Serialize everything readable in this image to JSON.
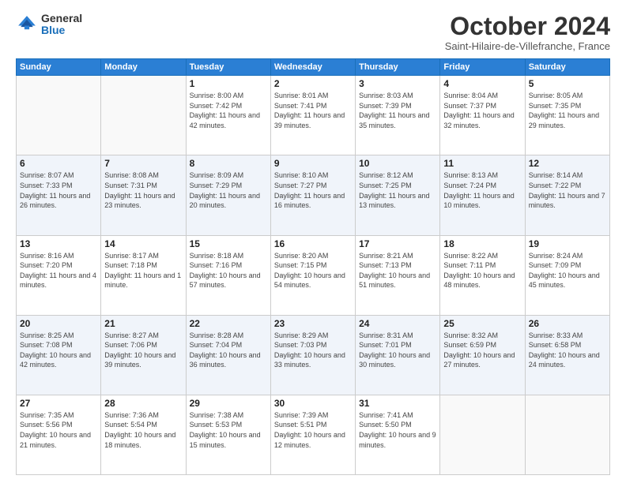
{
  "header": {
    "logo_general": "General",
    "logo_blue": "Blue",
    "title": "October 2024",
    "location": "Saint-Hilaire-de-Villefranche, France"
  },
  "weekdays": [
    "Sunday",
    "Monday",
    "Tuesday",
    "Wednesday",
    "Thursday",
    "Friday",
    "Saturday"
  ],
  "weeks": [
    [
      {
        "day": "",
        "sunrise": "",
        "sunset": "",
        "daylight": ""
      },
      {
        "day": "",
        "sunrise": "",
        "sunset": "",
        "daylight": ""
      },
      {
        "day": "1",
        "sunrise": "Sunrise: 8:00 AM",
        "sunset": "Sunset: 7:42 PM",
        "daylight": "Daylight: 11 hours and 42 minutes."
      },
      {
        "day": "2",
        "sunrise": "Sunrise: 8:01 AM",
        "sunset": "Sunset: 7:41 PM",
        "daylight": "Daylight: 11 hours and 39 minutes."
      },
      {
        "day": "3",
        "sunrise": "Sunrise: 8:03 AM",
        "sunset": "Sunset: 7:39 PM",
        "daylight": "Daylight: 11 hours and 35 minutes."
      },
      {
        "day": "4",
        "sunrise": "Sunrise: 8:04 AM",
        "sunset": "Sunset: 7:37 PM",
        "daylight": "Daylight: 11 hours and 32 minutes."
      },
      {
        "day": "5",
        "sunrise": "Sunrise: 8:05 AM",
        "sunset": "Sunset: 7:35 PM",
        "daylight": "Daylight: 11 hours and 29 minutes."
      }
    ],
    [
      {
        "day": "6",
        "sunrise": "Sunrise: 8:07 AM",
        "sunset": "Sunset: 7:33 PM",
        "daylight": "Daylight: 11 hours and 26 minutes."
      },
      {
        "day": "7",
        "sunrise": "Sunrise: 8:08 AM",
        "sunset": "Sunset: 7:31 PM",
        "daylight": "Daylight: 11 hours and 23 minutes."
      },
      {
        "day": "8",
        "sunrise": "Sunrise: 8:09 AM",
        "sunset": "Sunset: 7:29 PM",
        "daylight": "Daylight: 11 hours and 20 minutes."
      },
      {
        "day": "9",
        "sunrise": "Sunrise: 8:10 AM",
        "sunset": "Sunset: 7:27 PM",
        "daylight": "Daylight: 11 hours and 16 minutes."
      },
      {
        "day": "10",
        "sunrise": "Sunrise: 8:12 AM",
        "sunset": "Sunset: 7:25 PM",
        "daylight": "Daylight: 11 hours and 13 minutes."
      },
      {
        "day": "11",
        "sunrise": "Sunrise: 8:13 AM",
        "sunset": "Sunset: 7:24 PM",
        "daylight": "Daylight: 11 hours and 10 minutes."
      },
      {
        "day": "12",
        "sunrise": "Sunrise: 8:14 AM",
        "sunset": "Sunset: 7:22 PM",
        "daylight": "Daylight: 11 hours and 7 minutes."
      }
    ],
    [
      {
        "day": "13",
        "sunrise": "Sunrise: 8:16 AM",
        "sunset": "Sunset: 7:20 PM",
        "daylight": "Daylight: 11 hours and 4 minutes."
      },
      {
        "day": "14",
        "sunrise": "Sunrise: 8:17 AM",
        "sunset": "Sunset: 7:18 PM",
        "daylight": "Daylight: 11 hours and 1 minute."
      },
      {
        "day": "15",
        "sunrise": "Sunrise: 8:18 AM",
        "sunset": "Sunset: 7:16 PM",
        "daylight": "Daylight: 10 hours and 57 minutes."
      },
      {
        "day": "16",
        "sunrise": "Sunrise: 8:20 AM",
        "sunset": "Sunset: 7:15 PM",
        "daylight": "Daylight: 10 hours and 54 minutes."
      },
      {
        "day": "17",
        "sunrise": "Sunrise: 8:21 AM",
        "sunset": "Sunset: 7:13 PM",
        "daylight": "Daylight: 10 hours and 51 minutes."
      },
      {
        "day": "18",
        "sunrise": "Sunrise: 8:22 AM",
        "sunset": "Sunset: 7:11 PM",
        "daylight": "Daylight: 10 hours and 48 minutes."
      },
      {
        "day": "19",
        "sunrise": "Sunrise: 8:24 AM",
        "sunset": "Sunset: 7:09 PM",
        "daylight": "Daylight: 10 hours and 45 minutes."
      }
    ],
    [
      {
        "day": "20",
        "sunrise": "Sunrise: 8:25 AM",
        "sunset": "Sunset: 7:08 PM",
        "daylight": "Daylight: 10 hours and 42 minutes."
      },
      {
        "day": "21",
        "sunrise": "Sunrise: 8:27 AM",
        "sunset": "Sunset: 7:06 PM",
        "daylight": "Daylight: 10 hours and 39 minutes."
      },
      {
        "day": "22",
        "sunrise": "Sunrise: 8:28 AM",
        "sunset": "Sunset: 7:04 PM",
        "daylight": "Daylight: 10 hours and 36 minutes."
      },
      {
        "day": "23",
        "sunrise": "Sunrise: 8:29 AM",
        "sunset": "Sunset: 7:03 PM",
        "daylight": "Daylight: 10 hours and 33 minutes."
      },
      {
        "day": "24",
        "sunrise": "Sunrise: 8:31 AM",
        "sunset": "Sunset: 7:01 PM",
        "daylight": "Daylight: 10 hours and 30 minutes."
      },
      {
        "day": "25",
        "sunrise": "Sunrise: 8:32 AM",
        "sunset": "Sunset: 6:59 PM",
        "daylight": "Daylight: 10 hours and 27 minutes."
      },
      {
        "day": "26",
        "sunrise": "Sunrise: 8:33 AM",
        "sunset": "Sunset: 6:58 PM",
        "daylight": "Daylight: 10 hours and 24 minutes."
      }
    ],
    [
      {
        "day": "27",
        "sunrise": "Sunrise: 7:35 AM",
        "sunset": "Sunset: 5:56 PM",
        "daylight": "Daylight: 10 hours and 21 minutes."
      },
      {
        "day": "28",
        "sunrise": "Sunrise: 7:36 AM",
        "sunset": "Sunset: 5:54 PM",
        "daylight": "Daylight: 10 hours and 18 minutes."
      },
      {
        "day": "29",
        "sunrise": "Sunrise: 7:38 AM",
        "sunset": "Sunset: 5:53 PM",
        "daylight": "Daylight: 10 hours and 15 minutes."
      },
      {
        "day": "30",
        "sunrise": "Sunrise: 7:39 AM",
        "sunset": "Sunset: 5:51 PM",
        "daylight": "Daylight: 10 hours and 12 minutes."
      },
      {
        "day": "31",
        "sunrise": "Sunrise: 7:41 AM",
        "sunset": "Sunset: 5:50 PM",
        "daylight": "Daylight: 10 hours and 9 minutes."
      },
      {
        "day": "",
        "sunrise": "",
        "sunset": "",
        "daylight": ""
      },
      {
        "day": "",
        "sunrise": "",
        "sunset": "",
        "daylight": ""
      }
    ]
  ]
}
